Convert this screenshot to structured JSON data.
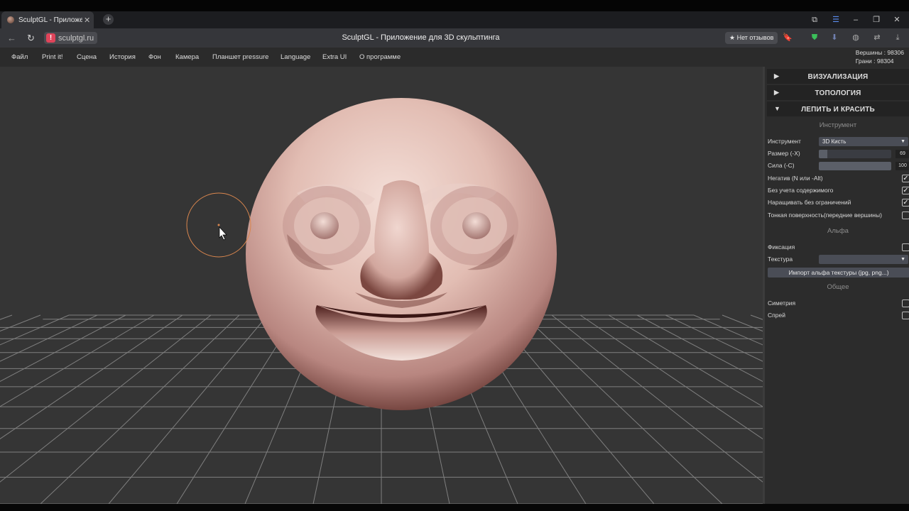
{
  "browser": {
    "tab_title": "SculptGL - Приложени",
    "tab_close": "✕",
    "new_tab": "+",
    "url_host": "sculptgl.ru",
    "page_title": "SculptGL - Приложение для 3D скульптинга",
    "review_chip": "★ Нет отзывов"
  },
  "menubar": {
    "items": [
      "Файл",
      "Print it!",
      "Сцена",
      "История",
      "Фон",
      "Камера",
      "Планшет pressure",
      "Language",
      "Extra UI",
      "О программе"
    ]
  },
  "stats": {
    "vertices": "Вершины : 98306",
    "faces": "Грани : 98304"
  },
  "panel": {
    "folds": [
      {
        "label": "ВИЗУАЛИЗАЦИЯ",
        "arrow": "▶"
      },
      {
        "label": "ТОПОЛОГИЯ",
        "arrow": "▶"
      },
      {
        "label": "ЛЕПИТЬ И КРАСИТЬ",
        "arrow": "▼"
      }
    ],
    "section_tool": "Инструмент",
    "tool_label": "Инструмент",
    "tool_value": "3D Кисть",
    "size_label": "Размер (-X)",
    "size_value": "69",
    "size_fraction": 0.12,
    "strength_label": "Сила (-C)",
    "strength_value": "100",
    "strength_fraction": 1.0,
    "checks": [
      {
        "label": "Негатив (N или -Alt)",
        "checked": true
      },
      {
        "label": "Без учета содержимого",
        "checked": true
      },
      {
        "label": "Наращивать без ограничений",
        "checked": true
      },
      {
        "label": "Тонкая поверхность(передние вершины)",
        "checked": false
      }
    ],
    "section_alpha": "Альфа",
    "lock_label": "Фиксация",
    "lock_checked": false,
    "texture_label": "Текстура",
    "texture_value": "",
    "import_label": "Импорт альфа текстуры (jpg, png...)",
    "section_common": "Общее",
    "symmetry_label": "Симетрия",
    "symmetry_checked": false,
    "spray_label": "Спрей",
    "spray_checked": false
  },
  "colors": {
    "accent_brush": "#d9864e",
    "sphere_light": "#f2dcd4",
    "sphere_dark": "#5a2a25"
  }
}
